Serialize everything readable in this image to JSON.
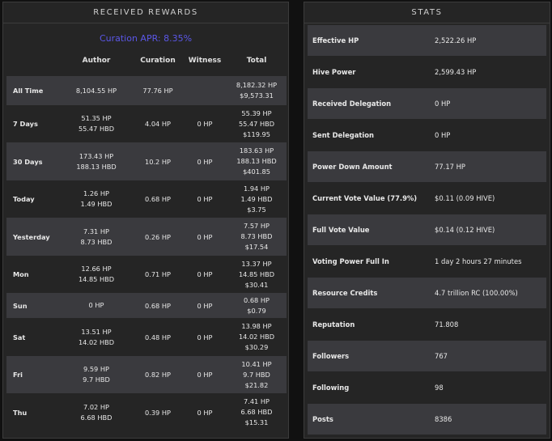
{
  "rewards": {
    "title": "RECEIVED REWARDS",
    "apr": "Curation APR: 8.35%",
    "columns": [
      "",
      "Author",
      "Curation",
      "Witness",
      "Total"
    ],
    "rows": [
      {
        "label": "All Time",
        "author": [
          "8,104.55 HP"
        ],
        "curation": "77.76 HP",
        "witness": "",
        "total": [
          "8,182.32 HP",
          "$9,573.31"
        ]
      },
      {
        "label": "7 Days",
        "author": [
          "51.35 HP",
          "55.47 HBD"
        ],
        "curation": "4.04 HP",
        "witness": "0 HP",
        "total": [
          "55.39 HP",
          "55.47 HBD",
          "$119.95"
        ]
      },
      {
        "label": "30 Days",
        "author": [
          "173.43 HP",
          "188.13 HBD"
        ],
        "curation": "10.2 HP",
        "witness": "0 HP",
        "total": [
          "183.63 HP",
          "188.13 HBD",
          "$401.85"
        ]
      },
      {
        "label": "Today",
        "author": [
          "1.26 HP",
          "1.49 HBD"
        ],
        "curation": "0.68 HP",
        "witness": "0 HP",
        "total": [
          "1.94 HP",
          "1.49 HBD",
          "$3.75"
        ]
      },
      {
        "label": "Yesterday",
        "author": [
          "7.31 HP",
          "8.73 HBD"
        ],
        "curation": "0.26 HP",
        "witness": "0 HP",
        "total": [
          "7.57 HP",
          "8.73 HBD",
          "$17.54"
        ]
      },
      {
        "label": "Mon",
        "author": [
          "12.66 HP",
          "14.85 HBD"
        ],
        "curation": "0.71 HP",
        "witness": "0 HP",
        "total": [
          "13.37 HP",
          "14.85 HBD",
          "$30.41"
        ]
      },
      {
        "label": "Sun",
        "author": [
          "0 HP"
        ],
        "curation": "0.68 HP",
        "witness": "0 HP",
        "total": [
          "0.68 HP",
          "$0.79"
        ]
      },
      {
        "label": "Sat",
        "author": [
          "13.51 HP",
          "14.02 HBD"
        ],
        "curation": "0.48 HP",
        "witness": "0 HP",
        "total": [
          "13.98 HP",
          "14.02 HBD",
          "$30.29"
        ]
      },
      {
        "label": "Fri",
        "author": [
          "9.59 HP",
          "9.7 HBD"
        ],
        "curation": "0.82 HP",
        "witness": "0 HP",
        "total": [
          "10.41 HP",
          "9.7 HBD",
          "$21.82"
        ]
      },
      {
        "label": "Thu",
        "author": [
          "7.02 HP",
          "6.68 HBD"
        ],
        "curation": "0.39 HP",
        "witness": "0 HP",
        "total": [
          "7.41 HP",
          "6.68 HBD",
          "$15.31"
        ]
      }
    ]
  },
  "stats": {
    "title": "STATS",
    "rows": [
      {
        "label": "Effective HP",
        "value": "2,522.26 HP"
      },
      {
        "label": "Hive Power",
        "value": "2,599.43 HP"
      },
      {
        "label": "Received Delegation",
        "value": "0 HP"
      },
      {
        "label": "Sent Delegation",
        "value": "0 HP"
      },
      {
        "label": "Power Down Amount",
        "value": "77.17 HP"
      },
      {
        "label": "Current Vote Value (77.9%)",
        "value": "$0.11 (0.09 HIVE)"
      },
      {
        "label": "Full Vote Value",
        "value": "$0.14 (0.12 HIVE)"
      },
      {
        "label": "Voting Power Full In",
        "value": "1 day 2 hours 27 minutes"
      },
      {
        "label": "Resource Credits",
        "value": "4.7 trillion RC (100.00%)"
      },
      {
        "label": "Reputation",
        "value": "71.808"
      },
      {
        "label": "Followers",
        "value": "767"
      },
      {
        "label": "Following",
        "value": "98"
      },
      {
        "label": "Posts",
        "value": "8386"
      }
    ]
  }
}
